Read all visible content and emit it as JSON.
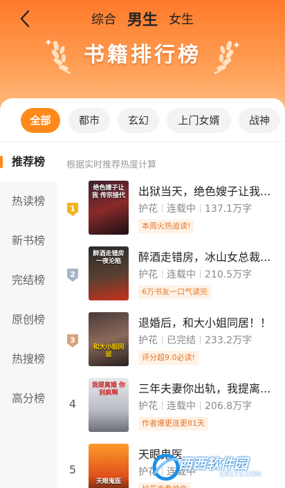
{
  "header": {
    "gender_tabs": [
      "综合",
      "男生",
      "女生"
    ],
    "title": "书籍排行榜"
  },
  "categories": [
    "全部",
    "都市",
    "玄幻",
    "上门女婿",
    "战神"
  ],
  "sidebar": [
    "推荐榜",
    "热读榜",
    "新书榜",
    "完结榜",
    "原创榜",
    "热搜榜",
    "高分榜"
  ],
  "note": "根据实时推荐热度计算",
  "books": [
    {
      "rank": "1",
      "title": "出狱当天，绝色嫂子让我...",
      "author": "护花",
      "status": "连载中",
      "words": "137.1万字",
      "tag": "本周火热追读!",
      "cover_text": "绝色嫂子让我 传宗接代"
    },
    {
      "rank": "2",
      "title": "醉酒走错房，冰山女总裁...",
      "author": "护花",
      "status": "连载中",
      "words": "210.5万字",
      "tag": "6万书友一口气读完",
      "cover_text": "醉酒走错房 一夜沦陷"
    },
    {
      "rank": "3",
      "title": "退婚后，和大小姐同居！！",
      "author": "护花",
      "status": "已完结",
      "words": "233.2万字",
      "tag": "评分超9.0必读!",
      "cover_text": "和大小姐同居"
    },
    {
      "rank": "4",
      "title": "三年夫妻你出轨，我提离...",
      "author": "护花",
      "status": "连载中",
      "words": "206.8万字",
      "tag": "作者爆更连更81天",
      "cover_text": "我提离婚 你别疯啊"
    },
    {
      "rank": "5",
      "title": "天眼鬼医",
      "author": "护花",
      "status": "连载中",
      "words": "",
      "tag": "护花言希神作",
      "cover_text": "天眼鬼医"
    }
  ],
  "watermark": {
    "brand": "西西软件园",
    "url": "CR173.COM"
  },
  "colors": {
    "accent": "#ff8a1c",
    "header_top": "#ff7a2a",
    "tag_bg": "#fff2e6",
    "tag_text": "#e8762a"
  }
}
